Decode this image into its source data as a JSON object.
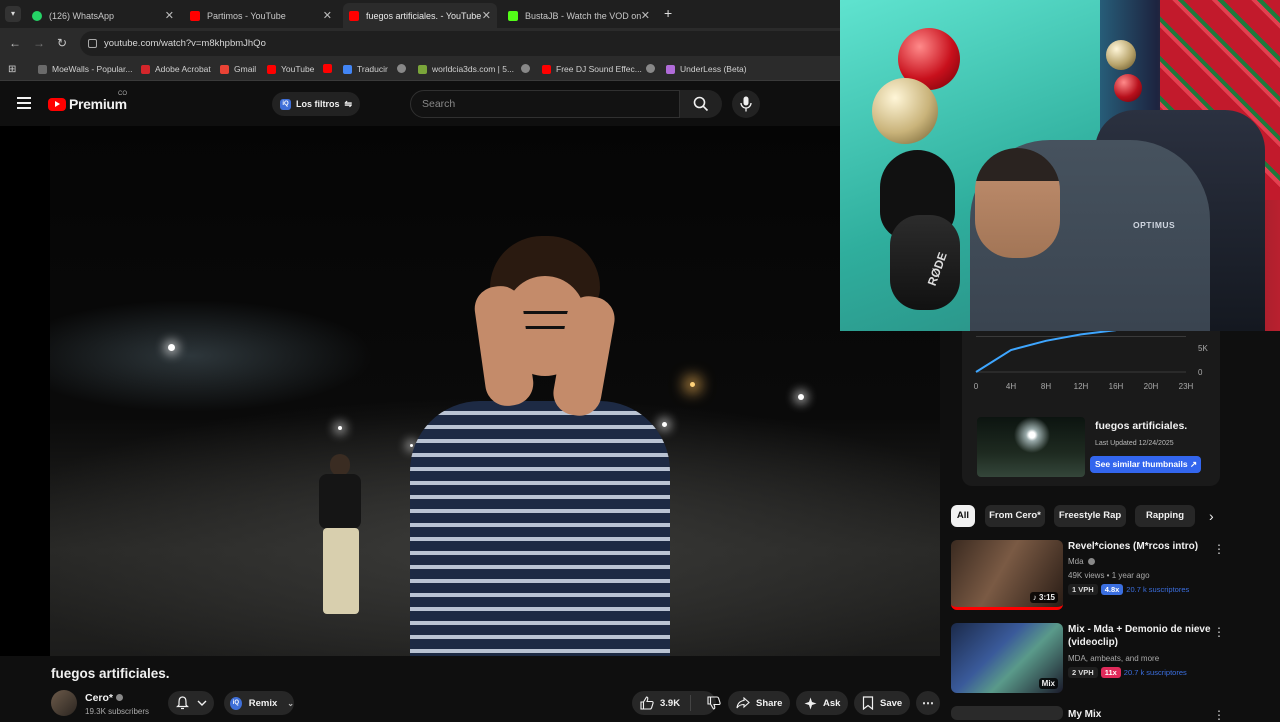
{
  "browser": {
    "tabs": [
      {
        "title": "(126) WhatsApp",
        "color": "#25d366",
        "active": false
      },
      {
        "title": "Partimos - YouTube",
        "color": "#ff0000",
        "active": false
      },
      {
        "title": "fuegos artificiales. - YouTube",
        "color": "#ff0000",
        "active": true
      },
      {
        "title": "BustaJB - Watch the VOD on Ki",
        "color": "#53fc18",
        "active": false
      }
    ],
    "url": "youtube.com/watch?v=m8khpbmJhQo",
    "bookmarks": [
      {
        "label": "MoeWalls - Popular...",
        "color": "#6a6a6a"
      },
      {
        "label": "Adobe Acrobat",
        "color": "#d4262b"
      },
      {
        "label": "Gmail",
        "color": "#ea4335"
      },
      {
        "label": "YouTube",
        "color": "#ff0000"
      },
      {
        "label": "",
        "color": "#ff0000"
      },
      {
        "label": "Traducir",
        "color": "#4285f4"
      },
      {
        "label": "",
        "color": "#888888"
      },
      {
        "label": "worldcia3ds.com | 5...",
        "color": "#7aa53a"
      },
      {
        "label": "",
        "color": "#888888"
      },
      {
        "label": "Free DJ Sound Effec...",
        "color": "#ff0000"
      },
      {
        "label": "",
        "color": "#888888"
      },
      {
        "label": "UnderLess (Beta)",
        "color": "#b06bd8"
      }
    ]
  },
  "youtube": {
    "logo_text": "Premium",
    "country_code": "CO",
    "filters_label": "Los filtros",
    "search_placeholder": "Search"
  },
  "video": {
    "title": "fuegos artificiales.",
    "channel": "Cero*",
    "subscribers": "19.3K subscribers",
    "remix_label": "Remix",
    "likes": "3.9K",
    "share_label": "Share",
    "ask_label": "Ask",
    "save_label": "Save"
  },
  "webcam": {
    "mic_brand": "RØDE",
    "chair_brand": "OPTIMUS"
  },
  "stats_card": {
    "y_ticks": [
      "5K",
      "0"
    ],
    "x_ticks": [
      "0",
      "4H",
      "8H",
      "12H",
      "16H",
      "20H",
      "23H"
    ],
    "thumb_title": "fuegos artificiales.",
    "last_updated": "Last Updated 12/24/2025",
    "similar_button": "See similar thumbnails ↗"
  },
  "chart_data": {
    "type": "line",
    "x": [
      "0",
      "4H",
      "8H",
      "12H",
      "16H",
      "20H",
      "23H"
    ],
    "values": [
      0,
      3100,
      4400,
      5300,
      5900,
      null,
      null
    ],
    "ylabel": "",
    "ylim": [
      0,
      10000
    ]
  },
  "chips": [
    "All",
    "From Cero*",
    "Freestyle Rap",
    "Rapping"
  ],
  "recommendations": [
    {
      "title": "Revel*ciones (M*rcos intro)",
      "channel": "Mda",
      "meta": "49K views • 1 year ago",
      "duration": "♪ 3:15",
      "vph": "1 VPH",
      "multiplier": "4.8x",
      "subs": "20.7 k suscriptores"
    },
    {
      "title": "Mix - Mda + Demonio de nieve (videoclip)",
      "channel": "MDA, ambeats, and more",
      "duration": "Mix",
      "vph": "2 VPH",
      "multiplier": "11x",
      "subs": "20.7 k suscriptores"
    },
    {
      "title": "My Mix"
    }
  ]
}
